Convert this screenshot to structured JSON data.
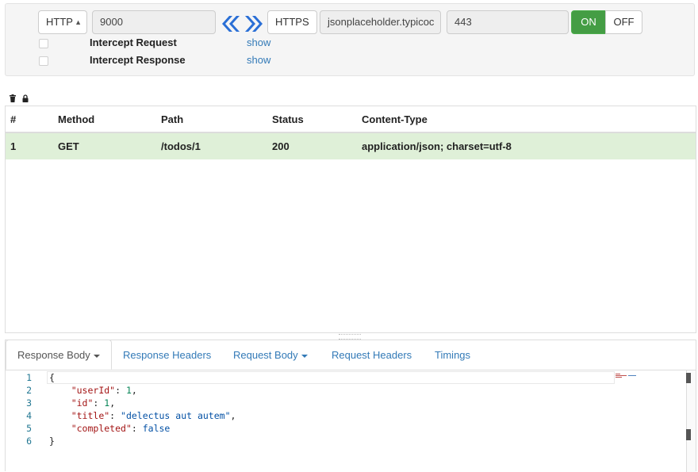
{
  "proxy": {
    "local_protocol": "HTTP",
    "local_port": "9000",
    "remote_protocol": "HTTPS",
    "remote_host": "jsonplaceholder.typicoc",
    "remote_port": "443",
    "on_label": "ON",
    "off_label": "OFF",
    "toggle_state": "ON",
    "intercept_request_label": "Intercept Request",
    "intercept_response_label": "Intercept Response",
    "show_label": "show"
  },
  "table": {
    "headers": [
      "#",
      "Method",
      "Path",
      "Status",
      "Content-Type"
    ],
    "rows": [
      [
        "1",
        "GET",
        "/todos/1",
        "200",
        "application/json; charset=utf-8"
      ]
    ]
  },
  "tabs": [
    "Response Body",
    "Response Headers",
    "Request Body",
    "Request Headers",
    "Timings"
  ],
  "active_tab": "Response Body",
  "editor": {
    "line_numbers": [
      "1",
      "2",
      "3",
      "4",
      "5",
      "6"
    ],
    "tokens": {
      "open": "{",
      "close": "}",
      "k_userId": "\"userId\"",
      "v_userId": "1",
      "k_id": "\"id\"",
      "v_id": "1",
      "k_title": "\"title\"",
      "v_title": "\"delectus aut autem\"",
      "k_completed": "\"completed\"",
      "v_completed": "false"
    }
  },
  "colors": {
    "on_button": "#449d44",
    "selected_row": "#dff0d8",
    "link": "#337ab7",
    "chevron": "#2a6fd6"
  },
  "icons": [
    "trash-icon",
    "lock-icon",
    "chevron-double-left-icon",
    "chevron-double-right-icon",
    "caret-down-icon"
  ]
}
